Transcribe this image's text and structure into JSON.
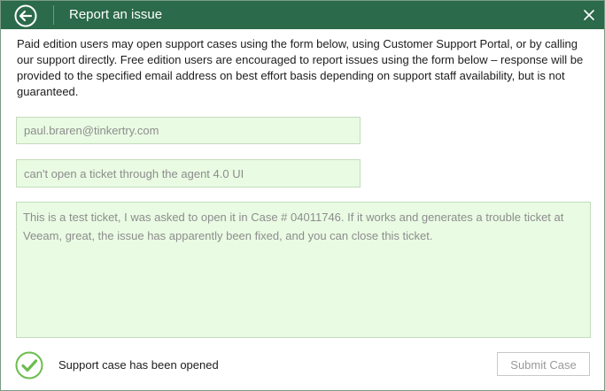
{
  "window": {
    "title": "Report an issue",
    "back_icon": "arrow-left-circle-icon",
    "close_icon": "close-icon",
    "titlebar_color": "#2b6a4a"
  },
  "description": "Paid edition users may open support cases using the form below, using Customer Support Portal, or by calling our support directly. Free edition users are encouraged to report issues using the form below – response will be provided to the specified email address on best effort basis depending on support staff availability, but is not guaranteed.",
  "form": {
    "email_value": "paul.braren@tinkertry.com",
    "subject_value": "can't open a ticket through the agent 4.0 UI",
    "body_value": "This is a test ticket, I was asked to open it in Case # 04011746. If it works and generates a trouble ticket at Veeam, great, the issue has apparently been fixed, and you can close this ticket.",
    "field_bg_color": "#e9fbe3"
  },
  "status": {
    "icon": "checkmark-circle-icon",
    "text": "Support case has been opened",
    "color": "#6cbd4f"
  },
  "submit_button": {
    "label": "Submit Case",
    "enabled": false
  }
}
